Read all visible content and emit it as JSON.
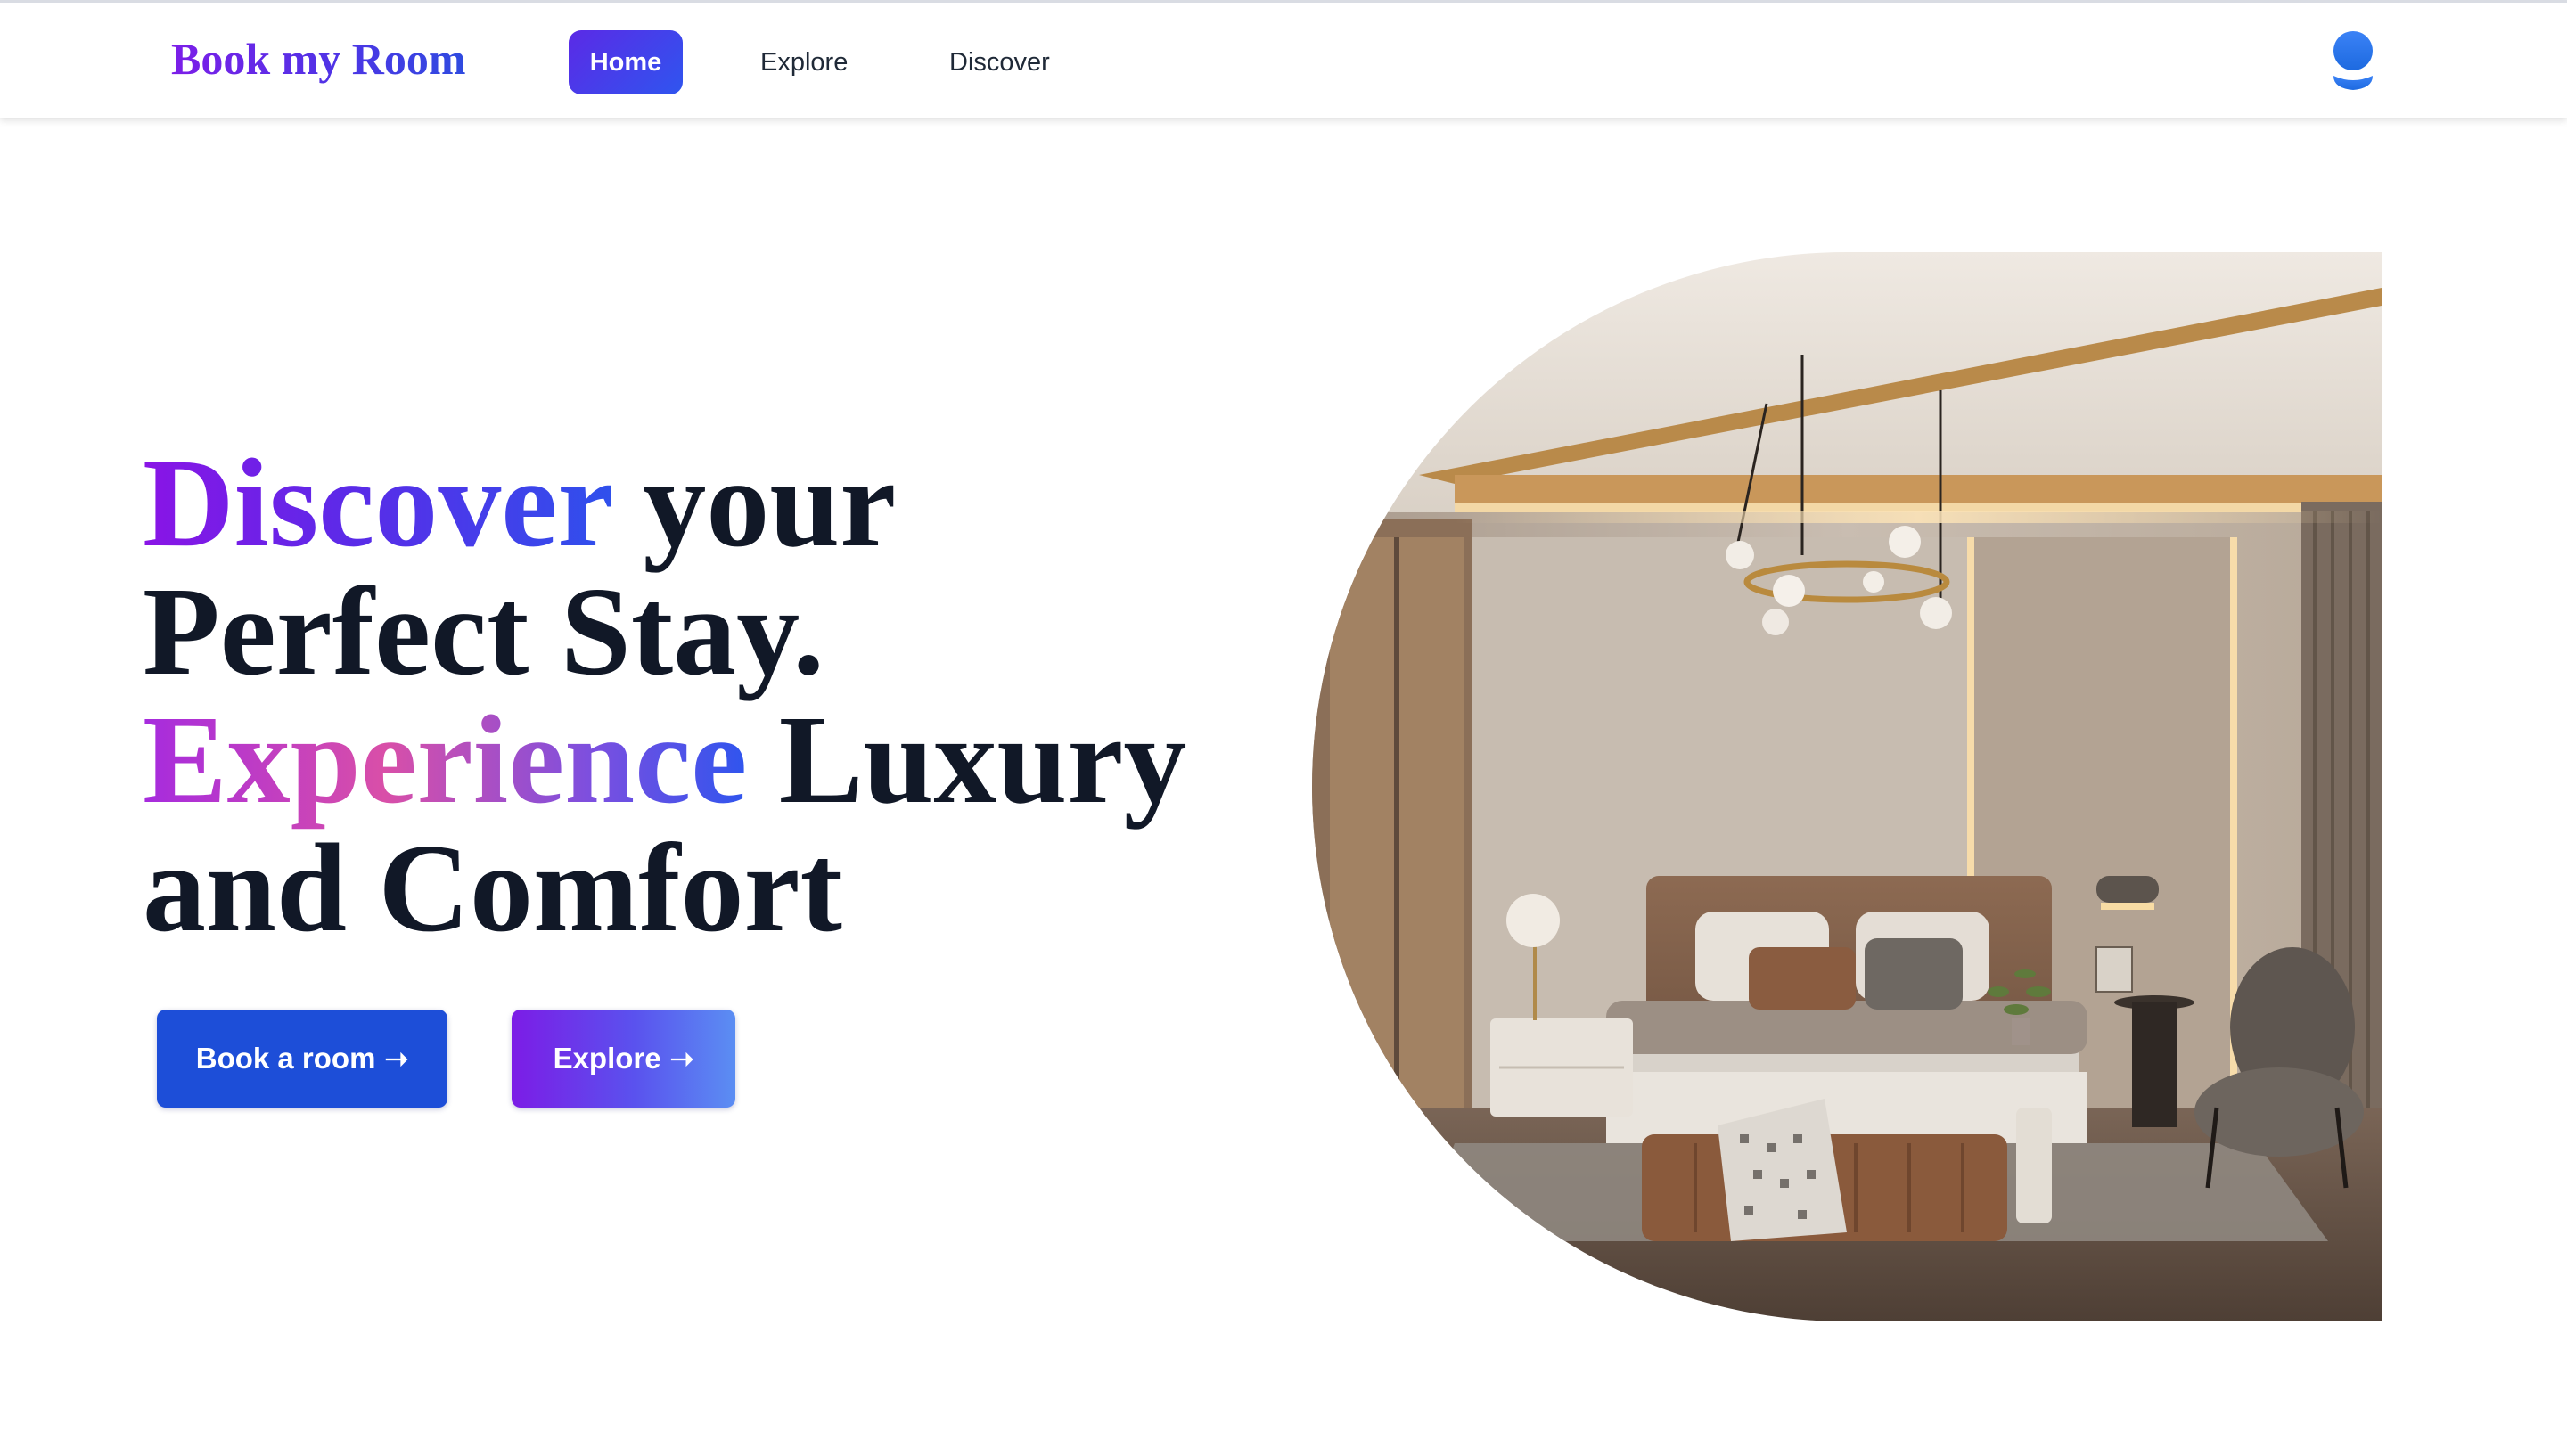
{
  "navbar": {
    "brand": "Book my Room",
    "links": [
      {
        "label": "Home",
        "active": true
      },
      {
        "label": "Explore",
        "active": false
      },
      {
        "label": "Discover",
        "active": false
      }
    ],
    "profile_icon": "user-icon"
  },
  "hero": {
    "title": {
      "line1_highlight": "Discover",
      "line1_rest": " your",
      "line2": "Perfect Stay.",
      "line3_highlight": "Experience",
      "line3_rest": " Luxury",
      "line4": "and Comfort"
    },
    "buttons": {
      "book_label": "Book a room",
      "explore_label": "Explore",
      "arrow": "➝"
    },
    "image": "luxury-bedroom-photo"
  },
  "colors": {
    "primary": "#1d4ed8",
    "accent_purple": "#7c1ce6",
    "accent_pink": "#d94fa8",
    "text_dark": "#111827"
  }
}
